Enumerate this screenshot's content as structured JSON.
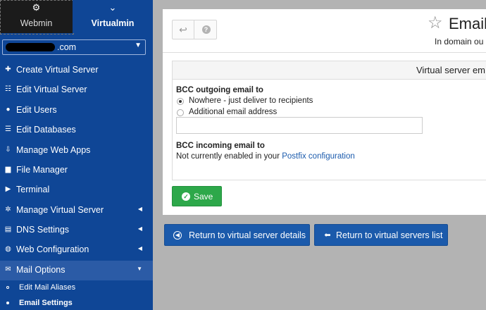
{
  "sidebar": {
    "tabs": [
      {
        "label": "Webmin",
        "icon": "webmin-icon"
      },
      {
        "label": "Virtualmin",
        "icon": "chevron-down-icon"
      }
    ],
    "domain_select": {
      "value": ".com"
    },
    "nav": [
      {
        "label": "Create Virtual Server",
        "icon": "plus-icon"
      },
      {
        "label": "Edit Virtual Server",
        "icon": "sliders-icon"
      },
      {
        "label": "Edit Users",
        "icon": "users-icon"
      },
      {
        "label": "Edit Databases",
        "icon": "database-icon"
      },
      {
        "label": "Manage Web Apps",
        "icon": "download-icon"
      },
      {
        "label": "File Manager",
        "icon": "file-icon"
      },
      {
        "label": "Terminal",
        "icon": "terminal-icon"
      },
      {
        "label": "Manage Virtual Server",
        "icon": "gears-icon"
      },
      {
        "label": "DNS Settings",
        "icon": "server-icon"
      },
      {
        "label": "Web Configuration",
        "icon": "globe-icon"
      },
      {
        "label": "Mail Options",
        "icon": "envelope-icon"
      }
    ],
    "sub_items": [
      {
        "label": "Edit Mail Aliases"
      },
      {
        "label": "Email Settings"
      }
    ]
  },
  "header": {
    "back_glyph": "↩",
    "help_glyph": "?",
    "star_glyph": "☆",
    "title": "Email",
    "subtitle": "In domain ou"
  },
  "section": {
    "title": "Virtual server em",
    "bcc_outgoing_label": "BCC outgoing email to",
    "options": [
      {
        "label": "Nowhere - just deliver to recipients",
        "checked": true
      },
      {
        "label": "Additional email address",
        "checked": false
      }
    ],
    "email_input": {
      "value": "",
      "placeholder": ""
    },
    "bcc_incoming_label": "BCC incoming email to",
    "incoming_text": "Not currently enabled in your ",
    "incoming_link": "Postfix configuration"
  },
  "buttons": {
    "save": "Save",
    "return_details": "Return to virtual server details",
    "return_list": "Return to virtual servers list"
  },
  "colors": {
    "sidebar_bg": "#0f4696",
    "sidebar_active": "#2b5ba6",
    "save_green": "#2da84a",
    "return_blue": "#1b5aab",
    "link_blue": "#1b5bad"
  }
}
